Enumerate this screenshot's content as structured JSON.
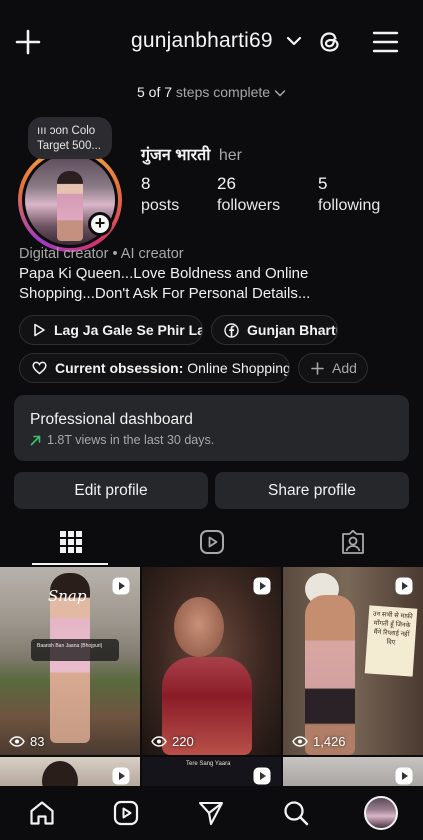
{
  "header": {
    "username": "gunjanbharti69"
  },
  "setup": {
    "count": "5 of 7",
    "suffix": "steps complete"
  },
  "note": {
    "line1": "ııı  ɔon Colo",
    "line2": "Target 500..."
  },
  "profile": {
    "name": "गुंजन भारती",
    "pronouns": "her",
    "stats": [
      {
        "value": "8",
        "label": "posts"
      },
      {
        "value": "26",
        "label": "followers"
      },
      {
        "value": "5",
        "label": "following"
      }
    ],
    "category": "Digital creator • AI creator",
    "bio_line1": "Papa Ki Queen...Love Boldness and Online",
    "bio_line2": "Shopping...Don't Ask For Personal Details..."
  },
  "links": {
    "music": "Lag Ja Gale Se Phir La...",
    "facebook": "Gunjan Bharti",
    "obsession_label": "Current obsession:",
    "obsession_value": "Online Shopping😜",
    "add": "Add"
  },
  "dashboard": {
    "title": "Professional dashboard",
    "subtitle": "1.8T views in the last 30 days.",
    "accent": "#3fbf6a"
  },
  "buttons": {
    "edit": "Edit profile",
    "share": "Share profile"
  },
  "grid": {
    "posts": [
      {
        "views": "83",
        "overlay": "Snap",
        "caption": "Baarish Ban Jaana (Bhojpuri)"
      },
      {
        "views": "220"
      },
      {
        "views": "1,426",
        "caption": "उन सभी से माफ़ी माँगती हूँ जिनके मैंने रिप्लाई नहीं दिए"
      },
      {},
      {
        "caption": "Tere Sang Yaara"
      },
      {}
    ]
  },
  "nav": {
    "items": [
      "home-icon",
      "reels-icon",
      "send-icon",
      "search-icon",
      "profile-avatar"
    ]
  }
}
